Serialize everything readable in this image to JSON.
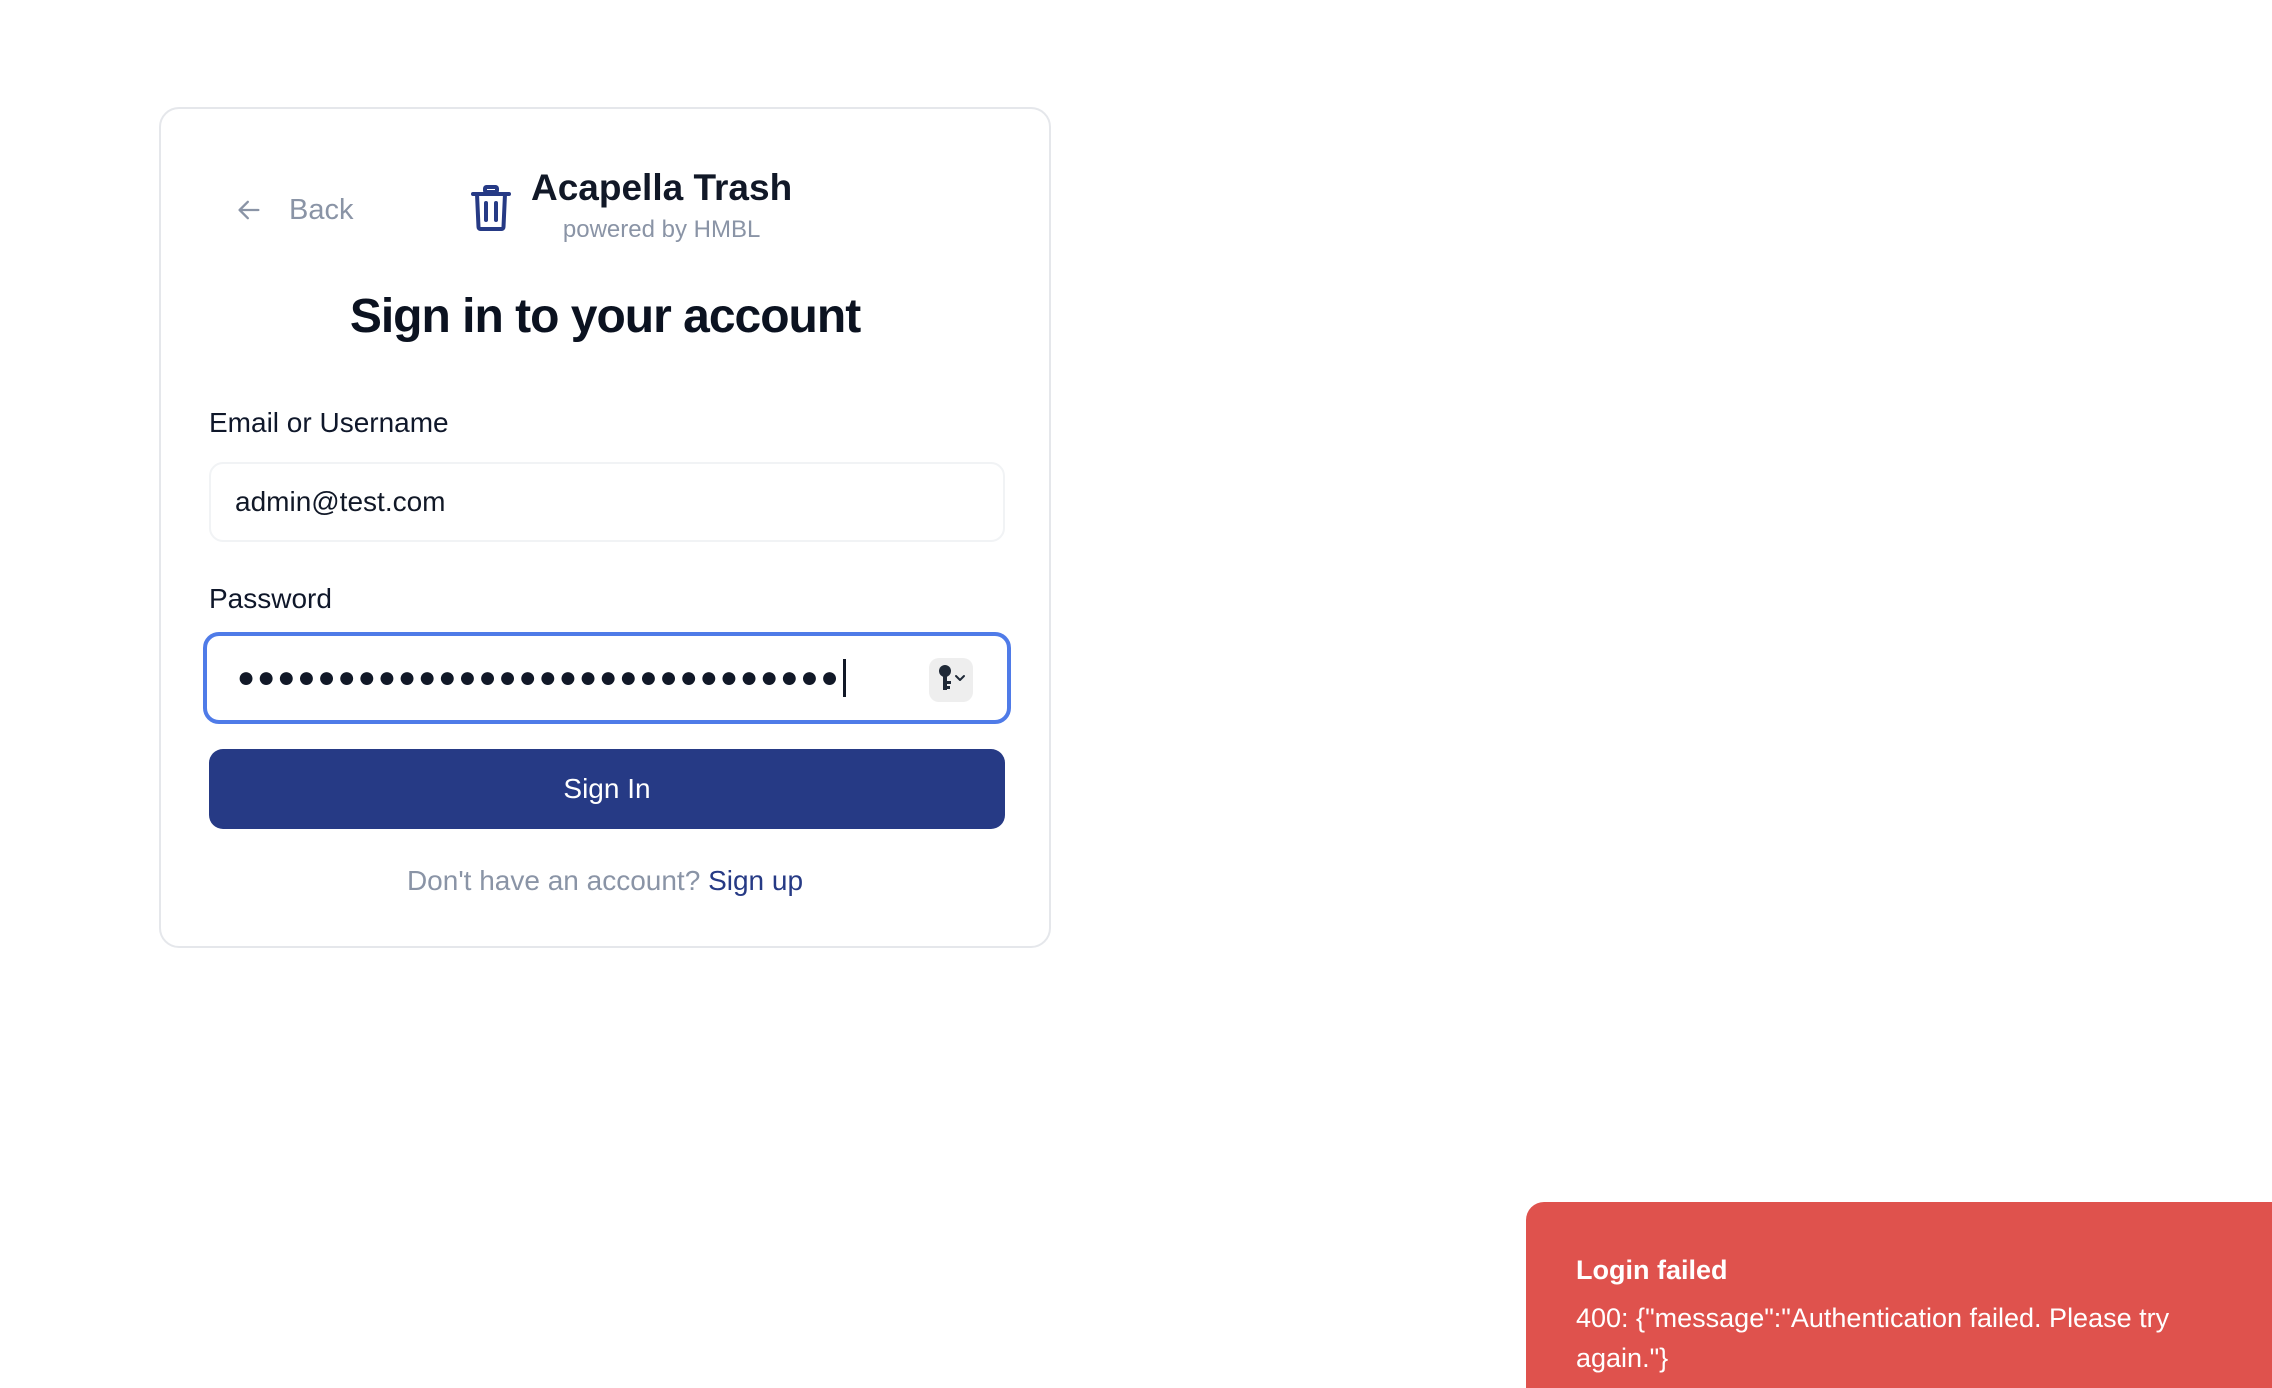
{
  "back": {
    "label": "Back",
    "icon": "arrow-left-icon"
  },
  "brand": {
    "name": "Acapella Trash",
    "subtitle": "powered by HMBL",
    "icon": "trash-icon",
    "color": "#263a85"
  },
  "heading": "Sign in to your account",
  "form": {
    "email_label": "Email or Username",
    "email_value": "admin@test.com",
    "password_label": "Password",
    "password_masked": "●●●●●●●●●●●●●●●●●●●●●●●●●●●●●●",
    "password_manager_icon": "key-icon",
    "submit_label": "Sign In"
  },
  "footer": {
    "prompt": "Don't have an account?",
    "link": "Sign up"
  },
  "toast": {
    "title": "Login failed",
    "message": "400: {\"message\":\"Authentication failed. Please try again.\"}",
    "color": "#df524d"
  },
  "colors": {
    "accent": "#263a85",
    "focus_ring": "#4f7be8",
    "muted": "#8a94a6"
  }
}
